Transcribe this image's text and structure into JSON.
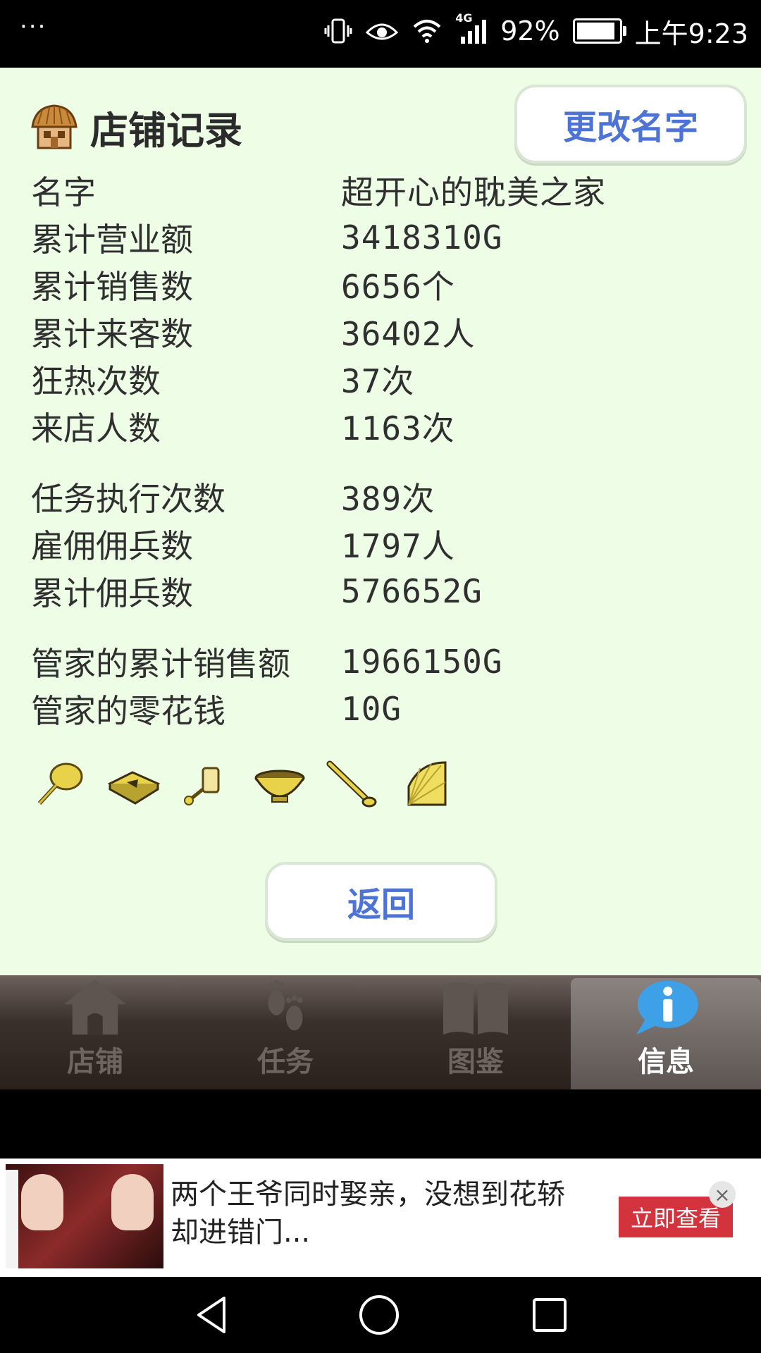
{
  "status_bar": {
    "dots": "···",
    "network": "4G",
    "battery_text": "92%",
    "battery_level": 0.92,
    "time": "上午9:23"
  },
  "shop_record": {
    "title": "店铺记录",
    "rename_button": "更改名字",
    "back_button": "返回",
    "group1": [
      {
        "label": "名字",
        "value": "超开心的耽美之家"
      },
      {
        "label": "累计营业额",
        "value": "3418310G"
      },
      {
        "label": "累计销售数",
        "value": "6656个"
      },
      {
        "label": "累计来客数",
        "value": "36402人"
      },
      {
        "label": "狂热次数",
        "value": "37次"
      },
      {
        "label": "来店人数",
        "value": "1163次"
      }
    ],
    "group2": [
      {
        "label": "任务执行次数",
        "value": "389次"
      },
      {
        "label": "雇佣佣兵数",
        "value": "1797人"
      },
      {
        "label": "累计佣兵数",
        "value": "576652G"
      }
    ],
    "group3": [
      {
        "label": "管家的累计销售额",
        "value": "1966150G"
      },
      {
        "label": "管家的零花钱",
        "value": "10G"
      }
    ],
    "items": [
      "fan-icon",
      "book-icon",
      "scroll-icon",
      "bowl-icon",
      "ladle-icon",
      "folding-fan-icon"
    ]
  },
  "tab_bar": {
    "tabs": [
      {
        "label": "店铺",
        "icon": "house-icon",
        "active": false
      },
      {
        "label": "任务",
        "icon": "footprints-icon",
        "active": false
      },
      {
        "label": "图鉴",
        "icon": "open-book-icon",
        "active": false
      },
      {
        "label": "信息",
        "icon": "info-bubble-icon",
        "active": true
      }
    ]
  },
  "ad": {
    "text": "两个王爷同时娶亲，没想到花轿却进错门...",
    "cta": "立即查看",
    "close": "×"
  },
  "colors": {
    "panel_bg": "#eefde6",
    "button_text": "#4d73d6",
    "ad_cta": "#d2333c"
  }
}
